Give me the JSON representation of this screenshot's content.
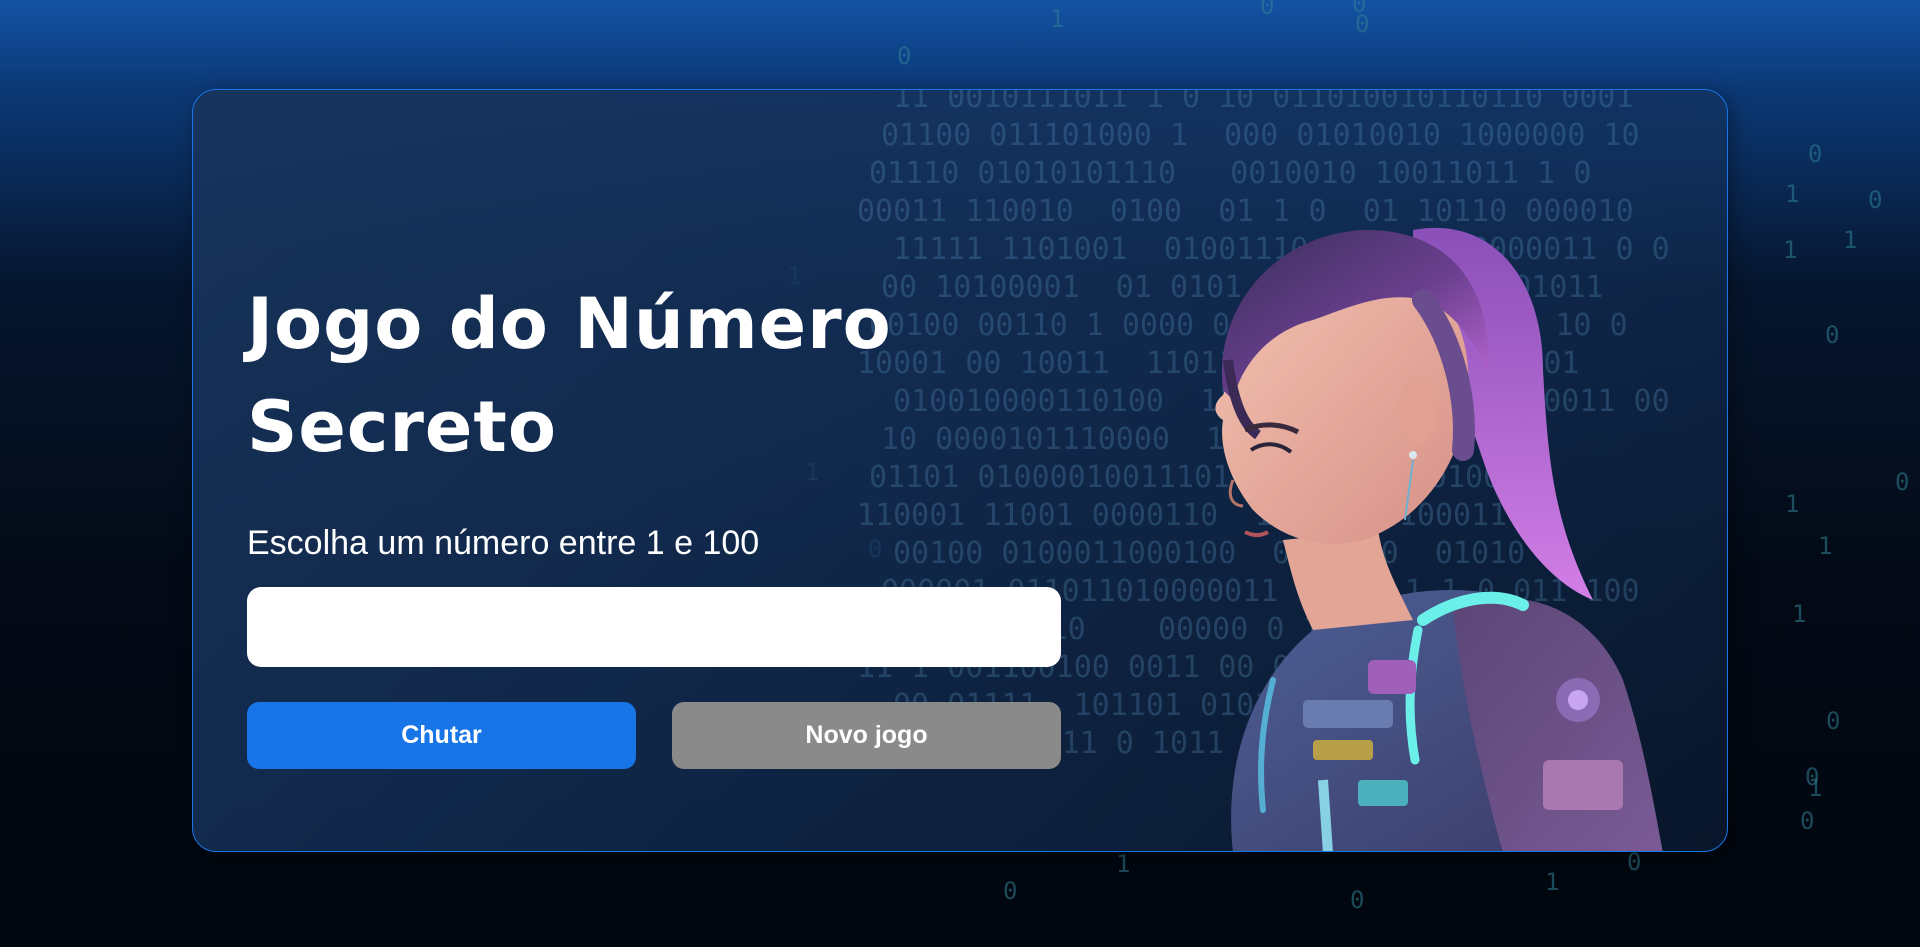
{
  "page": {
    "title_lines": [
      "Jogo do Número",
      "Secreto"
    ],
    "subtitle": "Escolha um número entre 1 e 100",
    "input": {
      "value": "",
      "placeholder": ""
    },
    "buttons": {
      "guess_label": "Chutar",
      "new_game_label": "Novo jogo"
    }
  },
  "illustration": {
    "icon": "astronaut-girl-illustration",
    "description_tag": "character-portrait"
  },
  "background": {
    "binary_lines": [
      "11 0010111011 1 0 10 011010010110110 0001",
      "01100 011101000 1  000 01010010 1000000 10",
      "01110 01010101110   0010010 10011011 1 0",
      "00011 110010  0100  01 1 0  01 10110 000010",
      "11111 1101001  01001110  11000  0000011 0 0",
      "00 10100001  01 0101  1  10011 1  001011",
      "00100 00110 1 0000 0  10 101101  10 1 10 0",
      "10001 00 10011  11011101  10010 10 1 101",
      "010010000110100  11110111011 00  0100011 00",
      "10 0000101110000  110110 01  10",
      "01101 01000010011101  0011 011 01000",
      "110001 11001 0000110  111 10 0100011 0",
      "00100 0100011000100  0010110  01010",
      "000001 011011010000011 10 10 1 1 0 011 100",
      "00000110  10    00000 0 10 0 00111 0 0",
      "11 1 001100100 0011 00 011 11 00 0",
      "00 01111  101101 0101010 1 0110 0 1",
      "10100 010 11 0 1011 11010 1"
    ],
    "accent_primary": "#1875e8",
    "accent_secondary": "#8a8a8a"
  }
}
